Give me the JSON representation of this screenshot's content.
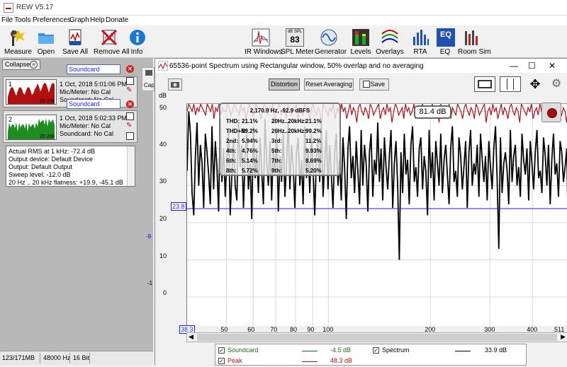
{
  "window": {
    "title": "REW V5.17"
  },
  "menu": [
    "File",
    "Tools",
    "Preferences",
    "Graph",
    "Help",
    "Donate"
  ],
  "toolbar": {
    "measure": "Measure",
    "open": "Open",
    "save_all": "Save All",
    "remove_all": "Remove All",
    "info": "Info",
    "ir_windows": "IR Windows",
    "spl_meter": "SPL Meter",
    "spl_value": "83",
    "spl_badge": "dB SPL",
    "generator": "Generator",
    "levels": "Levels",
    "overlays": "Overlays",
    "rta": "RTA",
    "eq": "EQ",
    "room_sim": "Room Sim"
  },
  "left": {
    "collapse": "Collapse",
    "m1": {
      "num": "1",
      "name": "Soundcard",
      "date": "1 Oct, 2018 5:01:06 PM",
      "mic": "Mic/Meter: No Cal",
      "sc": "Soundcard: No Cal",
      "thumb_label": "20 20k"
    },
    "m2": {
      "num": "2",
      "name": "Soundcard",
      "date": "1 Oct, 2018 5:02:33 PM",
      "mic": "Mic/Meter: No Cal",
      "sc": "Soundcard: No Cal",
      "thumb_label": "20 20k"
    },
    "info_lines": [
      "Actual RMS at 1 kHz: -72.4 dB",
      "Output device: Default Device",
      "Output: Default Output",
      "Sweep level: -12.0 dB",
      "20 Hz .. 20 kHz flatness: +19.9, -45.1 dB"
    ],
    "bg_label": "Cap",
    "bg_val1": "-9",
    "bg_val2": "-1"
  },
  "status": {
    "mem": "123/171MB",
    "rate": "48000 Hz",
    "bits": "16 Bit"
  },
  "spectrum": {
    "title": "65536-point Spectrum using Rectangular window, 50% overlap and no averaging",
    "btn_distortion": "Distortion",
    "btn_reset": "Reset Averaging",
    "btn_save": "Save",
    "yunit": "dB",
    "y_ticks": [
      "50",
      "40",
      "30",
      "20",
      "10",
      "0"
    ],
    "y_marker": "23.8",
    "x_ticks": [
      "50",
      "60",
      "70",
      "80",
      "90",
      "100",
      "200",
      "300",
      "400",
      "511"
    ],
    "x_start": "38.3",
    "readout": "81.4 dB",
    "dist": {
      "header": "2,170.9 Hz, -92.9 dBFS",
      "rows": [
        [
          "THD:",
          "21.1%",
          "20Hz..20kHz:",
          "21.1%"
        ],
        [
          "THD+N:",
          "99.2%",
          "20Hz..20kHz:",
          "99.2%"
        ],
        [
          "2nd:",
          "5.94%",
          "3rd:",
          "11.2%"
        ],
        [
          "4th:",
          "4.76%",
          "5th:",
          "9.93%"
        ],
        [
          "6th:",
          "5.14%",
          "7th:",
          "8.69%"
        ],
        [
          "8th:",
          "5.72%",
          "9th:",
          "5.20%"
        ]
      ]
    },
    "legend": [
      {
        "name": "Soundcard",
        "value": "-4.5 dB",
        "color": "#1e6b1e"
      },
      {
        "name": "Spectrum",
        "value": "33.9 dB",
        "color": "#000000"
      },
      {
        "name": "Peak",
        "value": "48.3 dB",
        "color": "#b01010"
      }
    ]
  },
  "chart_data": {
    "type": "line",
    "ylabel": "dB",
    "ylim": [
      -8,
      52
    ],
    "xlim": [
      38.3,
      511
    ],
    "x_scale": "log",
    "marker_y": 23.8,
    "series": [
      {
        "name": "Spectrum",
        "color": "#000000",
        "values": [
          34,
          50,
          44,
          28,
          22,
          38,
          47,
          30,
          41,
          36,
          24,
          44,
          39,
          33,
          25,
          46,
          29,
          42,
          35,
          23,
          48,
          31,
          40,
          27,
          37,
          45,
          22,
          33,
          43,
          30,
          26,
          47,
          35,
          41,
          24,
          38,
          44,
          29,
          36,
          21,
          46,
          32,
          39,
          28,
          43,
          34,
          25,
          48,
          37,
          30,
          42,
          26,
          40,
          33,
          45,
          23,
          38,
          31,
          44,
          27,
          36,
          47,
          29,
          41,
          35,
          24,
          39,
          43,
          30,
          37,
          25,
          46,
          32,
          40,
          28,
          44,
          34,
          22,
          38,
          42,
          31,
          47,
          27,
          36,
          45,
          29,
          41,
          33,
          24,
          39,
          44,
          30,
          37,
          26,
          43,
          35,
          21,
          40,
          46,
          32,
          38,
          28,
          42,
          34,
          25,
          45,
          30,
          41,
          36,
          23,
          39,
          44,
          27,
          37,
          33,
          47,
          31,
          40,
          26,
          43,
          35,
          29,
          38,
          45,
          24,
          36,
          42,
          30,
          10,
          39,
          28,
          44,
          33,
          37,
          25,
          41,
          46,
          31,
          35,
          27,
          40,
          43,
          29,
          38,
          34,
          22,
          45,
          32,
          39,
          26,
          42,
          36,
          30,
          44,
          28,
          37,
          41,
          33,
          25,
          40,
          46,
          31,
          34,
          27,
          43,
          38,
          29,
          35,
          42,
          24,
          39,
          45,
          30,
          36,
          33,
          41,
          27,
          44,
          37,
          31,
          38,
          26,
          42,
          35,
          29,
          40,
          46,
          32,
          13,
          43,
          28,
          36,
          39,
          34,
          25,
          45,
          31,
          38,
          41,
          30,
          35,
          27,
          44,
          37,
          33,
          40,
          26,
          42,
          36,
          29,
          39,
          45,
          32,
          34,
          28,
          43,
          38,
          30,
          41,
          25,
          37,
          44,
          33,
          36,
          27,
          42,
          39,
          31,
          35,
          40,
          14
        ]
      },
      {
        "name": "Peak",
        "color": "#b01010",
        "values": [
          50,
          52,
          51,
          50,
          52,
          49,
          51,
          50,
          52,
          51,
          50,
          49,
          52,
          51,
          50,
          52,
          48,
          51,
          50,
          52,
          49,
          51,
          50,
          50,
          52,
          51,
          49,
          50,
          52,
          51,
          50,
          49,
          52,
          50,
          51,
          48,
          50,
          52,
          51,
          49,
          50,
          52,
          51,
          50,
          48,
          51,
          52,
          50,
          49,
          51,
          50,
          52,
          47,
          50,
          51,
          52,
          49,
          50,
          51,
          48,
          52,
          50,
          49,
          51,
          50,
          52,
          48,
          51,
          50,
          49,
          52,
          51,
          50,
          48,
          51,
          52,
          50,
          49,
          51,
          50,
          47,
          52,
          51,
          50,
          49,
          51,
          50,
          52,
          48,
          50,
          51,
          49,
          52,
          50,
          51,
          48,
          50,
          52,
          49,
          51,
          50,
          47,
          51,
          52,
          50,
          49,
          51,
          50,
          48,
          52,
          51,
          49,
          50,
          51,
          52,
          48,
          50,
          51,
          49,
          52,
          50,
          51,
          47,
          50,
          52,
          51,
          49,
          50,
          51,
          48,
          52,
          50,
          51,
          49,
          50,
          52,
          48,
          51,
          50,
          49,
          52,
          51,
          50,
          48,
          51,
          50,
          52,
          49,
          50,
          51,
          47,
          52,
          50,
          51,
          49,
          50,
          52,
          48,
          51,
          50,
          49,
          52,
          51,
          50,
          48,
          51,
          52,
          50,
          49,
          51,
          50,
          48,
          52,
          51,
          49,
          50,
          51,
          52,
          47,
          50,
          51,
          49,
          52,
          50,
          51,
          48,
          50,
          52,
          49,
          51,
          50,
          48,
          51,
          52,
          50,
          49,
          51,
          50,
          47,
          52,
          51,
          50,
          49,
          51,
          50,
          52,
          48,
          50,
          51,
          49,
          52,
          50,
          51,
          48,
          50,
          52,
          49,
          51,
          50,
          48,
          51,
          52,
          50,
          49,
          51,
          50,
          47,
          52
        ]
      }
    ]
  }
}
